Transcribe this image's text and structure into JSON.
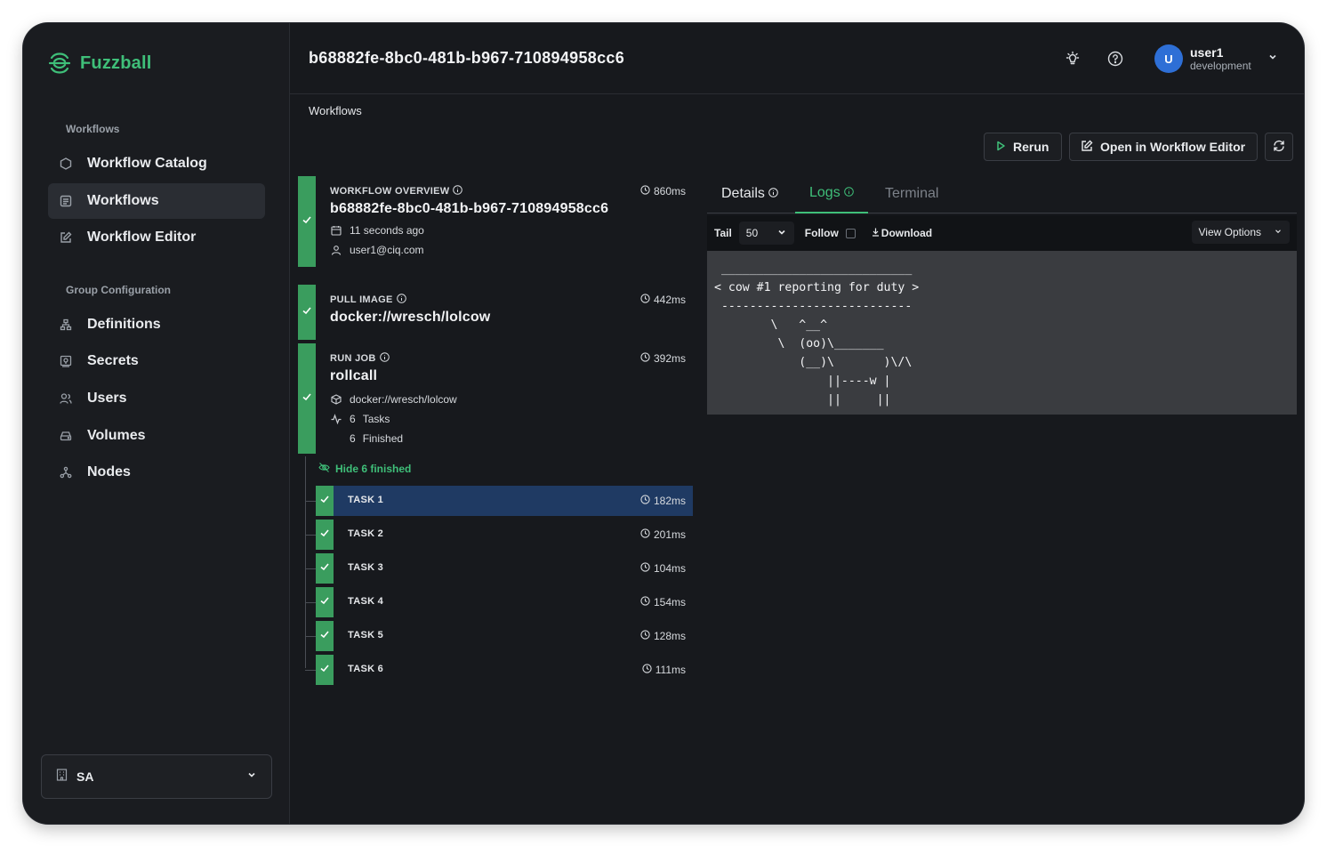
{
  "brand": {
    "name": "Fuzzball"
  },
  "sidebar": {
    "workflows_section": "Workflows",
    "workflow_items": [
      {
        "label": "Workflow Catalog",
        "icon": "hexagon-icon"
      },
      {
        "label": "Workflows",
        "icon": "list-icon"
      },
      {
        "label": "Workflow Editor",
        "icon": "edit-icon"
      }
    ],
    "group_section": "Group Configuration",
    "group_items": [
      {
        "label": "Definitions",
        "icon": "stack-icon"
      },
      {
        "label": "Secrets",
        "icon": "secret-icon"
      },
      {
        "label": "Users",
        "icon": "users-icon"
      },
      {
        "label": "Volumes",
        "icon": "drive-icon"
      },
      {
        "label": "Nodes",
        "icon": "nodes-icon"
      }
    ],
    "org_select": {
      "value": "SA"
    }
  },
  "header": {
    "title": "b68882fe-8bc0-481b-b967-710894958cc6",
    "user": {
      "initial": "U",
      "name": "user1",
      "role": "development"
    }
  },
  "breadcrumb": "Workflows",
  "actions": {
    "rerun": "Rerun",
    "open_editor": "Open in Workflow Editor"
  },
  "workflow": {
    "overview": {
      "kicker": "WORKFLOW OVERVIEW",
      "time": "860ms",
      "title": "b68882fe-8bc0-481b-b967-710894958cc6",
      "created": "11 seconds ago",
      "owner": "user1@ciq.com"
    },
    "pull": {
      "kicker": "PULL IMAGE",
      "time": "442ms",
      "title": "docker://wresch/lolcow"
    },
    "job": {
      "kicker": "RUN JOB",
      "time": "392ms",
      "title": "rollcall",
      "image": "docker://wresch/lolcow",
      "tasks_count": "6",
      "tasks_label": "Tasks",
      "finished_count": "6",
      "finished_label": "Finished"
    },
    "hide_link": "Hide 6 finished",
    "tasks": [
      {
        "name": "TASK 1",
        "time": "182ms"
      },
      {
        "name": "TASK 2",
        "time": "201ms"
      },
      {
        "name": "TASK 3",
        "time": "104ms"
      },
      {
        "name": "TASK 4",
        "time": "154ms"
      },
      {
        "name": "TASK 5",
        "time": "128ms"
      },
      {
        "name": "TASK 6",
        "time": "111ms"
      }
    ],
    "selected_task": "TASK 1"
  },
  "tabs": {
    "details": "Details",
    "logs": "Logs",
    "terminal": "Terminal",
    "active": "Logs"
  },
  "log_toolbar": {
    "tail_label": "Tail",
    "tail_value": "50",
    "follow_label": "Follow",
    "follow_checked": false,
    "download": "Download",
    "view_options": "View Options"
  },
  "log_output": " ___________________________\n< cow #1 reporting for duty >\n ---------------------------\n        \\   ^__^\n         \\  (oo)\\_______\n            (__)\\       )\\/\\\n                ||----w |\n                ||     ||",
  "colors": {
    "accent": "#3fbf79",
    "step_bar": "#3a9d5e",
    "selected_row": "#1f3a63",
    "avatar": "#2e6fd6"
  }
}
